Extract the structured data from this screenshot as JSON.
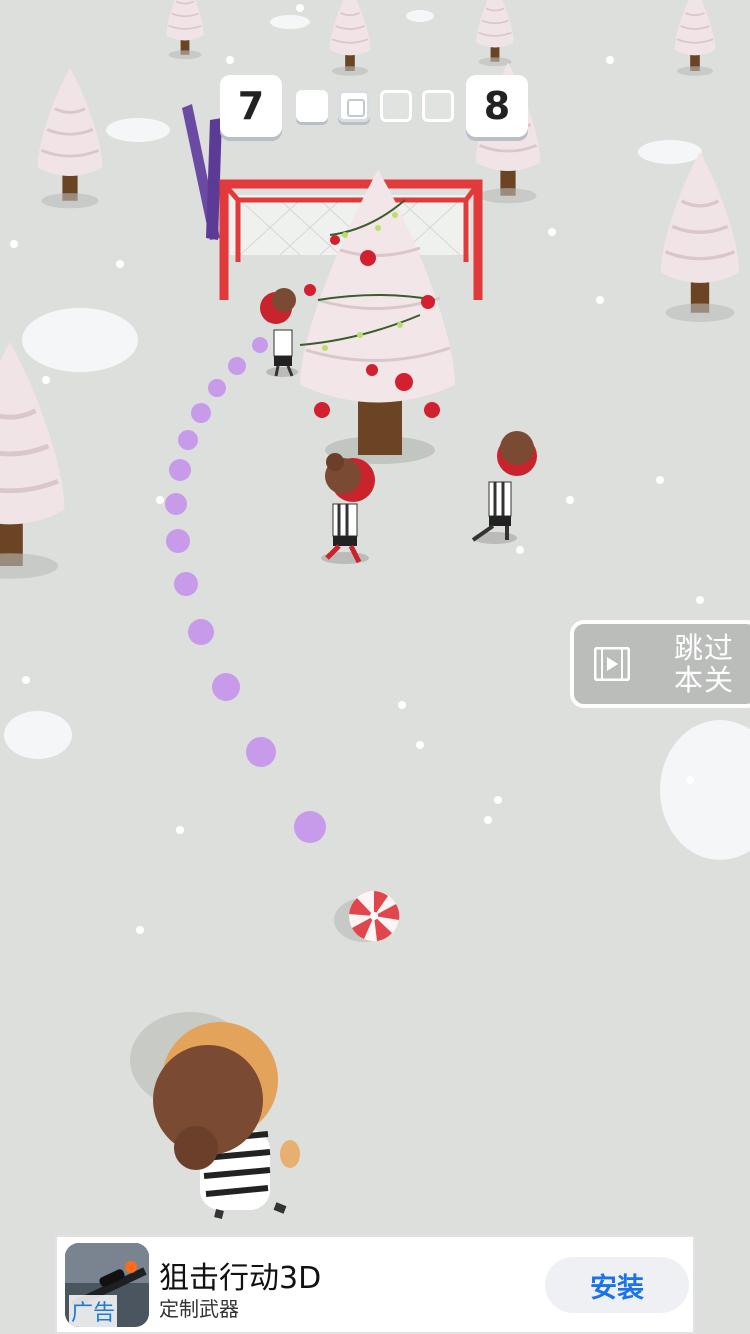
{
  "hud": {
    "current_level": "7",
    "next_level": "8",
    "stages": [
      "done",
      "current",
      "todo",
      "todo"
    ]
  },
  "skip_button": {
    "label_line1": "跳过",
    "label_line2": "本关",
    "icon": "video-icon"
  },
  "ad_banner": {
    "title": "狙击行动3D",
    "subtitle": "定制武器",
    "tag": "广告",
    "install_label": "安装",
    "accent": "#1a73e8"
  },
  "scene": {
    "background_color": "#dcdfdb",
    "trajectory_color": "#c79bea",
    "goal_color": "#e23a3a",
    "ball": "peppermint-ball"
  }
}
